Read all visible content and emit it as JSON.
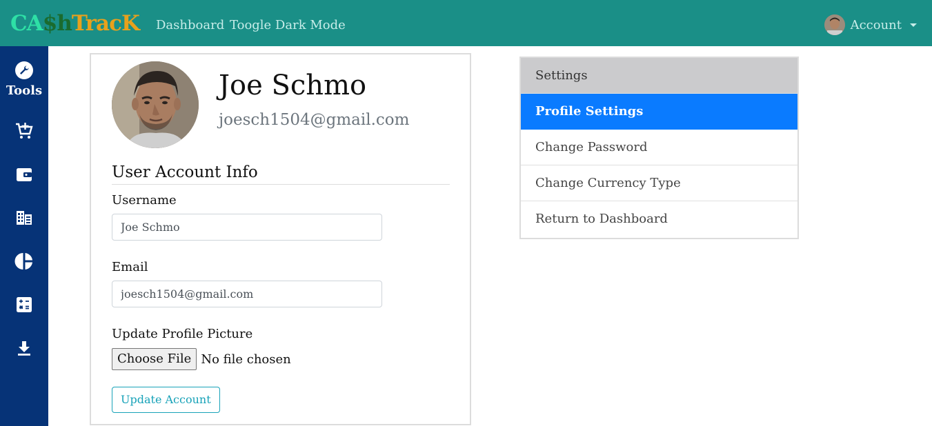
{
  "brand": {
    "part1": "CA",
    "part2": "$",
    "part3": "h",
    "part4": "TracK"
  },
  "nav": {
    "dashboard": "Dashboard",
    "dark_mode": "Toogle Dark Mode",
    "account": "Account"
  },
  "sidebar": {
    "tools_label": "Tools",
    "icons": [
      "add-to-cart-icon",
      "wallet-icon",
      "ledger-icon",
      "pie-chart-icon",
      "calculator-icon",
      "download-icon"
    ]
  },
  "profile": {
    "name": "Joe Schmo",
    "email": "joesch1504@gmail.com",
    "section_title": "User Account Info",
    "username_label": "Username",
    "username_value": "Joe Schmo",
    "email_label": "Email",
    "email_value": "joesch1504@gmail.com",
    "picture_label": "Update Profile Picture",
    "choose_file": "Choose File",
    "no_file": "No file chosen",
    "update_button": "Update Account"
  },
  "settings": {
    "header": "Settings",
    "items": [
      "Profile Settings",
      "Change Password",
      "Change Currency Type",
      "Return to Dashboard"
    ]
  },
  "colors": {
    "navbar": "#1a8f87",
    "sidebar": "#063377",
    "active": "#0a7bff",
    "accent": "#17a2b8"
  }
}
